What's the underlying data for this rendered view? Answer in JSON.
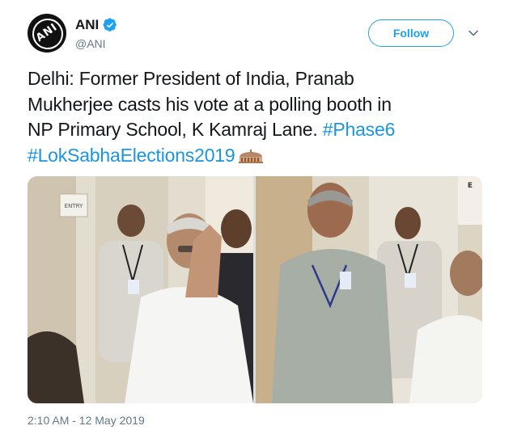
{
  "account": {
    "display_name": "ANI",
    "handle": "@ANI",
    "avatar_text": "ANI",
    "verified": true
  },
  "follow_button": {
    "label": "Follow"
  },
  "tweet": {
    "line1": "Delhi: Former President of India, Pranab",
    "line2": "Mukherjee casts his vote at a polling booth in",
    "line3_text": "NP Primary School, K Kamraj Lane. ",
    "hashtag1": "#Phase6",
    "hashtag2": "#LokSabhaElections2019",
    "emoji": "parliament-building-emoji"
  },
  "media": {
    "sign_text": "ENTRY",
    "right_sign_text": "E"
  },
  "timestamp": "2:10 AM - 12 May 2019",
  "colors": {
    "accent": "#1da1f2",
    "hashtag": "#1b95e0",
    "secondary_text": "#657786",
    "primary_text": "#14171a"
  }
}
